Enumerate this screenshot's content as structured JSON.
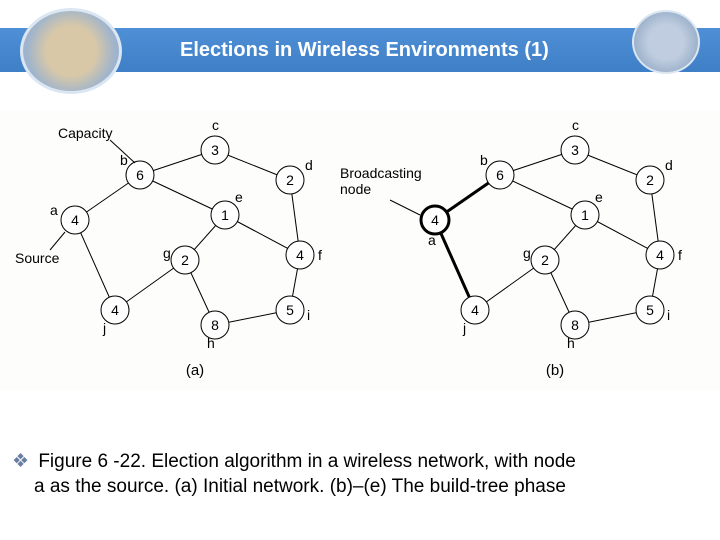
{
  "header": {
    "title": "Elections in Wireless Environments (1)"
  },
  "annotations": {
    "a": {
      "capacity": "Capacity",
      "source": "Source",
      "sublabel": "(a)"
    },
    "b": {
      "broadcast": "Broadcasting\nnode",
      "sublabel": "(b)"
    }
  },
  "nodes": {
    "a": {
      "label": "a",
      "cap": "4"
    },
    "b": {
      "label": "b",
      "cap": "6"
    },
    "c": {
      "label": "c",
      "cap": "3"
    },
    "d": {
      "label": "d",
      "cap": "2"
    },
    "e": {
      "label": "e",
      "cap": "1"
    },
    "f": {
      "label": "f",
      "cap": "4"
    },
    "g": {
      "label": "g",
      "cap": "2"
    },
    "h": {
      "label": "h",
      "cap": "8"
    },
    "i": {
      "label": "i",
      "cap": "5"
    },
    "j": {
      "label": "j",
      "cap": "4"
    }
  },
  "caption": {
    "text1": "Figure 6 -22. Election algorithm in a wireless network, with node",
    "text2": "a as the source. (a) Initial network. (b)–(e) The build-tree phase"
  },
  "chart_data": {
    "type": "diagram",
    "title": "Election algorithm in a wireless network",
    "panels": [
      {
        "id": "a",
        "description": "Initial network",
        "annotations": [
          "Capacity",
          "Source"
        ],
        "nodes": [
          {
            "id": "a",
            "capacity": 4,
            "role": "source"
          },
          {
            "id": "b",
            "capacity": 6
          },
          {
            "id": "c",
            "capacity": 3
          },
          {
            "id": "d",
            "capacity": 2
          },
          {
            "id": "e",
            "capacity": 1
          },
          {
            "id": "f",
            "capacity": 4
          },
          {
            "id": "g",
            "capacity": 2
          },
          {
            "id": "h",
            "capacity": 8
          },
          {
            "id": "i",
            "capacity": 5
          },
          {
            "id": "j",
            "capacity": 4
          }
        ],
        "edges": [
          [
            "a",
            "b"
          ],
          [
            "a",
            "j"
          ],
          [
            "b",
            "c"
          ],
          [
            "b",
            "e"
          ],
          [
            "c",
            "d"
          ],
          [
            "d",
            "f"
          ],
          [
            "e",
            "g"
          ],
          [
            "e",
            "f"
          ],
          [
            "g",
            "j"
          ],
          [
            "g",
            "h"
          ],
          [
            "h",
            "i"
          ],
          [
            "f",
            "i"
          ]
        ]
      },
      {
        "id": "b",
        "description": "Build-tree phase",
        "annotations": [
          "Broadcasting node"
        ],
        "broadcasting_node": "a",
        "nodes": [
          {
            "id": "a",
            "capacity": 4,
            "role": "broadcasting"
          },
          {
            "id": "b",
            "capacity": 6
          },
          {
            "id": "c",
            "capacity": 3
          },
          {
            "id": "d",
            "capacity": 2
          },
          {
            "id": "e",
            "capacity": 1
          },
          {
            "id": "f",
            "capacity": 4
          },
          {
            "id": "g",
            "capacity": 2
          },
          {
            "id": "h",
            "capacity": 8
          },
          {
            "id": "i",
            "capacity": 5
          },
          {
            "id": "j",
            "capacity": 4
          }
        ],
        "edges": [
          [
            "a",
            "b"
          ],
          [
            "a",
            "j"
          ],
          [
            "b",
            "c"
          ],
          [
            "b",
            "e"
          ],
          [
            "c",
            "d"
          ],
          [
            "d",
            "f"
          ],
          [
            "e",
            "g"
          ],
          [
            "e",
            "f"
          ],
          [
            "g",
            "j"
          ],
          [
            "g",
            "h"
          ],
          [
            "h",
            "i"
          ],
          [
            "f",
            "i"
          ]
        ],
        "bold_edges": [
          [
            "a",
            "b"
          ],
          [
            "a",
            "j"
          ]
        ]
      }
    ]
  }
}
